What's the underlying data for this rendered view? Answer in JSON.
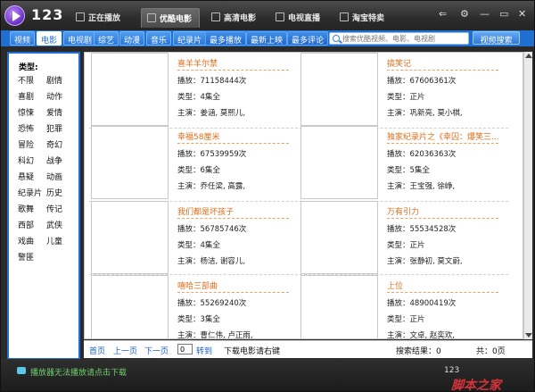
{
  "app": {
    "brand": "123"
  },
  "main_tabs": [
    {
      "label": "正在播放"
    },
    {
      "label": "优酷电影"
    },
    {
      "label": "高清电影"
    },
    {
      "label": "电视直播"
    },
    {
      "label": "淘宝特卖"
    }
  ],
  "window_controls": {
    "back": "⇐",
    "settings": "⚙",
    "minimize": "—",
    "maximize": "▭",
    "close": "✕"
  },
  "category_tabs": [
    {
      "label": "视频"
    },
    {
      "label": "电影"
    },
    {
      "label": "电视剧"
    },
    {
      "label": "综艺"
    },
    {
      "label": "动漫"
    },
    {
      "label": "音乐"
    },
    {
      "label": "纪录片"
    }
  ],
  "sort_tabs": [
    {
      "label": "最多播放"
    },
    {
      "label": "最新上映"
    },
    {
      "label": "最多评论"
    }
  ],
  "search": {
    "placeholder": "搜索优酷视频、电影、电视剧",
    "button_label": "视频搜索"
  },
  "sidebar": {
    "title": "类型:",
    "genres": [
      "不限",
      "剧情",
      "喜剧",
      "动作",
      "惊悚",
      "爱情",
      "恐怖",
      "犯罪",
      "冒险",
      "奇幻",
      "科幻",
      "战争",
      "悬疑",
      "动画",
      "纪录片",
      "历史",
      "歌舞",
      "传记",
      "西部",
      "武侠",
      "戏曲",
      "儿童",
      "警匪"
    ]
  },
  "movies": [
    {
      "title": "喜羊羊尔禁",
      "plays": "播放：71158444次",
      "type": "类型：4集全",
      "cast": "主演：姜涵, 莫熙儿,"
    },
    {
      "title": "搞笑记",
      "plays": "播放：67606361次",
      "type": "类型：正片",
      "cast": "主演：巩新亮, 莫小棋,"
    },
    {
      "title": "幸福58厘米",
      "plays": "播放：67539959次",
      "type": "类型：6集全",
      "cast": "主演：乔任梁, 高露,"
    },
    {
      "title": "独家纪录片之《幸囚：爆笑三...",
      "plays": "播放：62036363次",
      "type": "类型：5集全",
      "cast": "主演：王宝强, 徐峥,"
    },
    {
      "title": "我们都是坏孩子",
      "plays": "播放：56785746次",
      "type": "类型：4集全",
      "cast": "主演：杨洁, 谢容儿,"
    },
    {
      "title": "万有引力",
      "plays": "播放：55534528次",
      "type": "类型：正片",
      "cast": "主演：张静初, 莫文蔚,"
    },
    {
      "title": "嘻哈三部曲",
      "plays": "播放：55269240次",
      "type": "类型：3集全",
      "cast": "主演：曹仁伟, 卢正雨,"
    },
    {
      "title": "上位",
      "plays": "播放：48900419次",
      "type": "类型：正片",
      "cast": "主演：文卓, 赵奕欢,"
    }
  ],
  "pager": {
    "first": "首页",
    "prev": "上一页",
    "next": "下一页",
    "page_value": "0",
    "goto": "转到",
    "download_hint": "下载电影请右键",
    "search_results": "搜索结果：0",
    "total": "共：0页"
  },
  "status": {
    "message": "播放器无法播放请点击下载",
    "right_text": "123"
  },
  "watermark": "脚本之家"
}
